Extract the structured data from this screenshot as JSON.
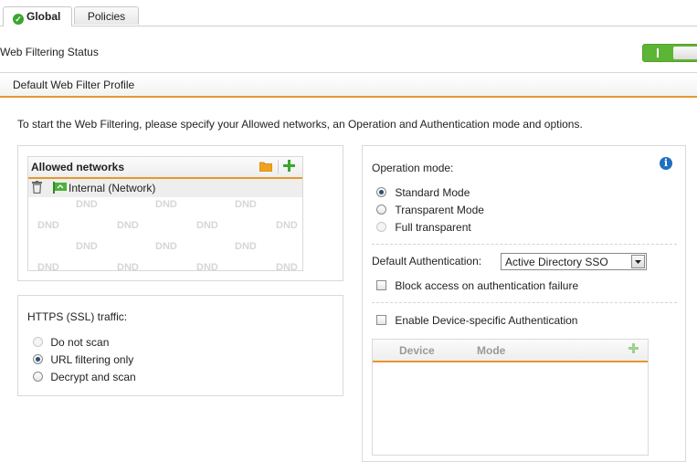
{
  "tabs": [
    {
      "label": "Global",
      "active": true
    },
    {
      "label": "Policies",
      "active": false
    }
  ],
  "status": {
    "label": "Web Filtering Status",
    "toggle_on": true
  },
  "profile": {
    "title": "Default Web Filter Profile"
  },
  "intro": "To start the Web Filtering, please specify your Allowed networks, an Operation and Authentication mode and options.",
  "allowed_networks": {
    "title": "Allowed networks",
    "items": [
      {
        "name": "Internal (Network)"
      }
    ],
    "dnd_label": "DND"
  },
  "https": {
    "title": "HTTPS (SSL) traffic:",
    "options": [
      "Do not scan",
      "URL filtering only",
      "Decrypt and scan"
    ],
    "selected": "URL filtering only"
  },
  "operation": {
    "title": "Operation mode:",
    "options": [
      "Standard Mode",
      "Transparent Mode",
      "Full transparent"
    ],
    "selected": "Standard Mode"
  },
  "auth": {
    "label": "Default Authentication:",
    "value": "Active Directory SSO",
    "block_label": "Block access on authentication failure",
    "device_label": "Enable Device-specific Authentication"
  },
  "device_table": {
    "columns": [
      "Device",
      "Mode"
    ]
  },
  "colors": {
    "accent": "#e8962e",
    "toggle": "#5db535",
    "info": "#1f6fc0"
  }
}
